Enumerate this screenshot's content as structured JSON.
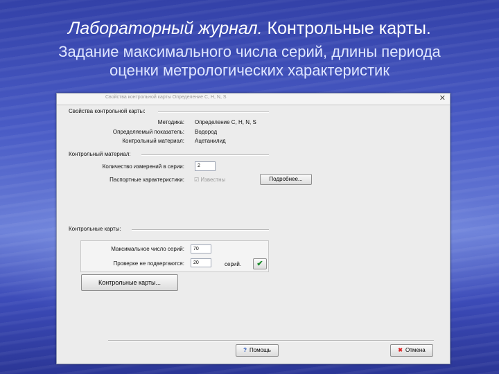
{
  "slide": {
    "title_italic": "Лабораторный журнал.",
    "title_normal": " Контрольные карты.",
    "subtitle_line1": "Задание максимального числа серий, длины периода",
    "subtitle_line2": "оценки метрологических характеристик"
  },
  "window": {
    "title": "Свойства контрольной карты    Определение C, H, N, S",
    "close_glyph": "✕"
  },
  "props": {
    "section": "Свойства контрольной карты:",
    "method_label": "Методика:",
    "method_value": "Определение C, H, N, S",
    "indicator_label": "Определяемый показатель:",
    "indicator_value": "Водород",
    "material_label": "Контрольный материал:",
    "material_value": "Ацетанилид"
  },
  "control_material": {
    "section": "Контрольный материал:",
    "count_label": "Количество измерений в серии:",
    "count_value": "2",
    "passport_label": "Паспортные характеристики:",
    "known_glyph": "☑",
    "known_label": "Известны",
    "details_button": "Подробнее..."
  },
  "control_charts": {
    "section": "Контрольные карты:",
    "max_series_label": "Максимальное число серий:",
    "max_series_value": "70",
    "not_checked_label": "Проверке не подвергаются:",
    "not_checked_value": "20",
    "series_unit": "серий.",
    "apply_glyph": "✔",
    "charts_button": "Контрольные карты..."
  },
  "footer": {
    "help_glyph": "?",
    "help_button": "Помощь",
    "cancel_glyph": "✖",
    "cancel_button": "Отмена"
  }
}
